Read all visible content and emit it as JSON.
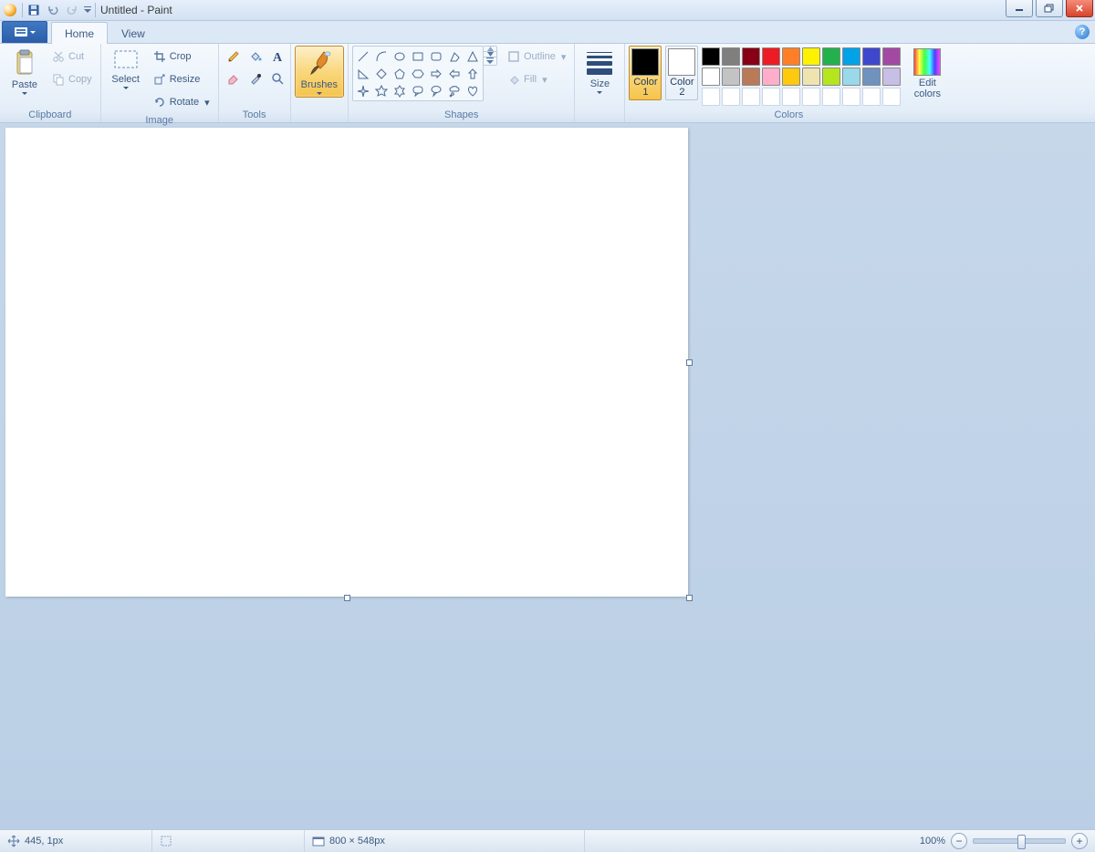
{
  "title": "Untitled - Paint",
  "tabs": {
    "home": "Home",
    "view": "View"
  },
  "groups": {
    "clipboard": "Clipboard",
    "image": "Image",
    "tools": "Tools",
    "shapes": "Shapes",
    "colors": "Colors"
  },
  "clipboard": {
    "paste": "Paste",
    "cut": "Cut",
    "copy": "Copy"
  },
  "image": {
    "select": "Select",
    "crop": "Crop",
    "resize": "Resize",
    "rotate": "Rotate"
  },
  "brushes": "Brushes",
  "shape_opts": {
    "outline": "Outline",
    "fill": "Fill"
  },
  "size": "Size",
  "color1": "Color\n1",
  "color2": "Color\n2",
  "edit_colors": "Edit\ncolors",
  "palette_row1": [
    "#000000",
    "#7F7F7F",
    "#880015",
    "#ED1C24",
    "#FF7F27",
    "#FFF200",
    "#22B14C",
    "#00A2E8",
    "#3F48CC",
    "#A349A4"
  ],
  "palette_row2": [
    "#FFFFFF",
    "#C3C3C3",
    "#B97A57",
    "#FFAEC9",
    "#FFC90E",
    "#EFE4B0",
    "#B5E61D",
    "#99D9EA",
    "#7092BE",
    "#C8BFE7"
  ],
  "color1_value": "#000000",
  "color2_value": "#FFFFFF",
  "status": {
    "cursor": "445, 1px",
    "selection": "",
    "canvas": "800 × 548px",
    "zoom": "100%"
  }
}
